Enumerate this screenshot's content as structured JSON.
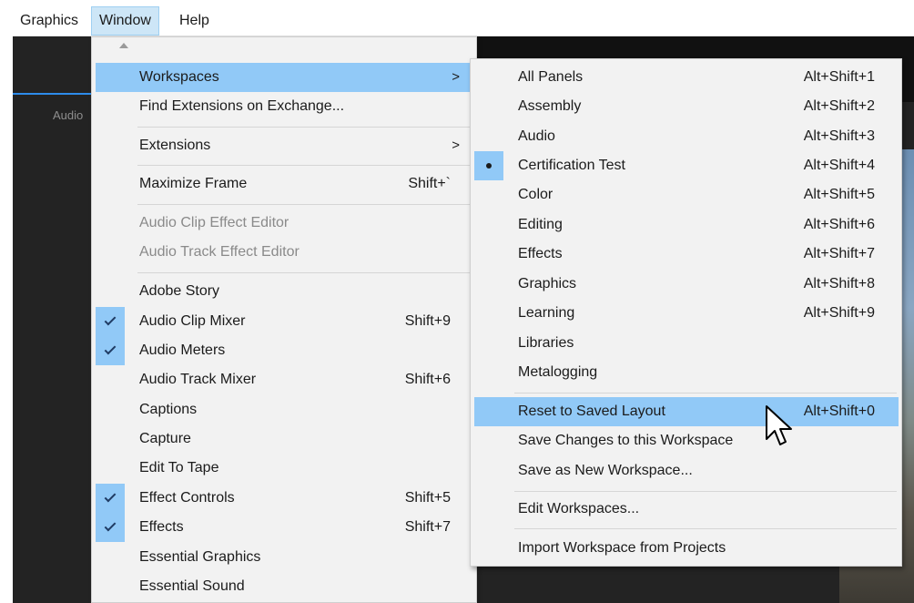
{
  "menubar": {
    "items": [
      "Graphics",
      "Window",
      "Help"
    ]
  },
  "background": {
    "panel_label": "Audio"
  },
  "window_menu": {
    "workspaces": {
      "label": "Workspaces",
      "arrow": ">"
    },
    "find_extensions": {
      "label": "Find Extensions on Exchange..."
    },
    "extensions": {
      "label": "Extensions",
      "arrow": ">"
    },
    "maximize_frame": {
      "label": "Maximize Frame",
      "shortcut": "Shift+`"
    },
    "audio_clip_effect_editor": {
      "label": "Audio Clip Effect Editor"
    },
    "audio_track_effect_editor": {
      "label": "Audio Track Effect Editor"
    },
    "adobe_story": {
      "label": "Adobe Story"
    },
    "audio_clip_mixer": {
      "label": "Audio Clip Mixer",
      "shortcut": "Shift+9",
      "checked": true
    },
    "audio_meters": {
      "label": "Audio Meters",
      "checked": true
    },
    "audio_track_mixer": {
      "label": "Audio Track Mixer",
      "shortcut": "Shift+6"
    },
    "captions": {
      "label": "Captions"
    },
    "capture": {
      "label": "Capture"
    },
    "edit_to_tape": {
      "label": "Edit To Tape"
    },
    "effect_controls": {
      "label": "Effect Controls",
      "shortcut": "Shift+5",
      "checked": true
    },
    "effects": {
      "label": "Effects",
      "shortcut": "Shift+7",
      "checked": true
    },
    "essential_graphics": {
      "label": "Essential Graphics"
    },
    "essential_sound": {
      "label": "Essential Sound"
    }
  },
  "workspaces_menu": {
    "all_panels": {
      "label": "All Panels",
      "shortcut": "Alt+Shift+1"
    },
    "assembly": {
      "label": "Assembly",
      "shortcut": "Alt+Shift+2"
    },
    "audio": {
      "label": "Audio",
      "shortcut": "Alt+Shift+3"
    },
    "certification_test": {
      "label": "Certification Test",
      "shortcut": "Alt+Shift+4",
      "selected": true
    },
    "color": {
      "label": "Color",
      "shortcut": "Alt+Shift+5"
    },
    "editing": {
      "label": "Editing",
      "shortcut": "Alt+Shift+6"
    },
    "effects": {
      "label": "Effects",
      "shortcut": "Alt+Shift+7"
    },
    "graphics": {
      "label": "Graphics",
      "shortcut": "Alt+Shift+8"
    },
    "learning": {
      "label": "Learning",
      "shortcut": "Alt+Shift+9"
    },
    "libraries": {
      "label": "Libraries"
    },
    "metalogging": {
      "label": "Metalogging"
    },
    "reset_layout": {
      "label": "Reset to Saved Layout",
      "shortcut": "Alt+Shift+0"
    },
    "save_changes": {
      "label": "Save Changes to this Workspace"
    },
    "save_new": {
      "label": "Save as New Workspace..."
    },
    "edit_workspaces": {
      "label": "Edit Workspaces..."
    },
    "import_workspace": {
      "label": "Import Workspace from Projects"
    }
  },
  "colors": {
    "highlight": "#91c9f7",
    "menu_bg": "#f2f2f2",
    "app_bg": "#232323",
    "accent_blue": "#2d8ceb"
  }
}
